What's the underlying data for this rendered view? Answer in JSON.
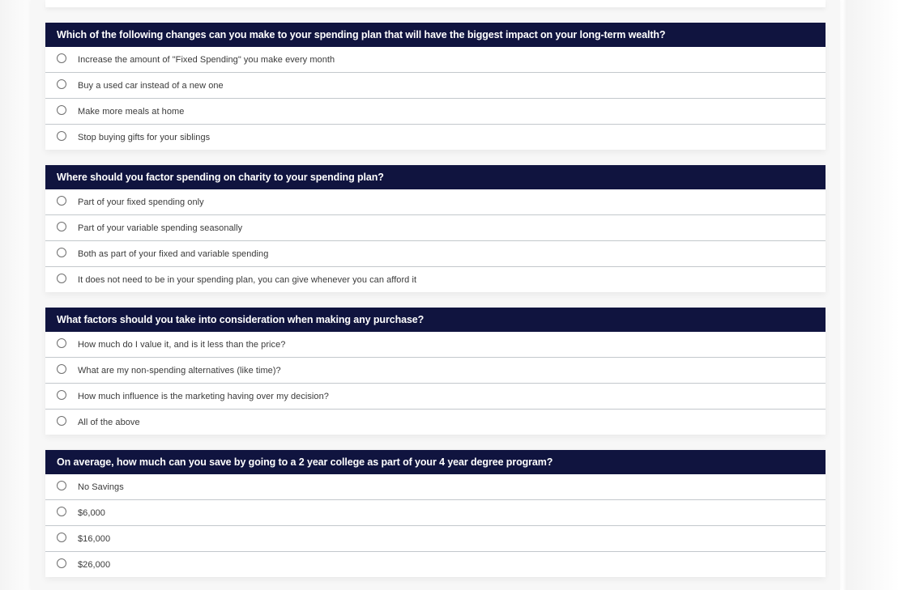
{
  "questions": [
    {
      "title": "Which of the following changes can you make to your spending plan that will have the biggest impact on your long-term wealth?",
      "options": [
        {
          "label": "Increase the amount of \"Fixed Spending\" you make every month",
          "selected": false
        },
        {
          "label": "Buy a used car instead of a new one",
          "selected": false
        },
        {
          "label": "Make more meals at home",
          "selected": false
        },
        {
          "label": "Stop buying gifts for your siblings",
          "selected": false
        }
      ]
    },
    {
      "title": "Where should you factor spending on charity to your spending plan?",
      "options": [
        {
          "label": "Part of your fixed spending only",
          "selected": false
        },
        {
          "label": "Part of your variable spending seasonally",
          "selected": false
        },
        {
          "label": "Both as part of your fixed and variable spending",
          "selected": false
        },
        {
          "label": "It does not need to be in your spending plan, you can give whenever you can afford it",
          "selected": false
        }
      ]
    },
    {
      "title": "What factors should you take into consideration when making any purchase?",
      "options": [
        {
          "label": "How much do I value it, and is it less than the price?",
          "selected": false
        },
        {
          "label": "What are my non-spending alternatives (like time)?",
          "selected": false
        },
        {
          "label": "How much influence is the marketing having over my decision?",
          "selected": false
        },
        {
          "label": "All of the above",
          "selected": false
        }
      ]
    },
    {
      "title": "On average, how much can you save by going to a 2 year college as part of your 4 year degree program?",
      "options": [
        {
          "label": "No Savings",
          "selected": false
        },
        {
          "label": "$6,000",
          "selected": false
        },
        {
          "label": "$16,000",
          "selected": false
        },
        {
          "label": "$26,000",
          "selected": false
        }
      ]
    }
  ],
  "colors": {
    "header_bg": "#10143f",
    "header_text": "#ffffff",
    "divider": "#c3c8cc",
    "option_text": "#3a3a3a"
  }
}
